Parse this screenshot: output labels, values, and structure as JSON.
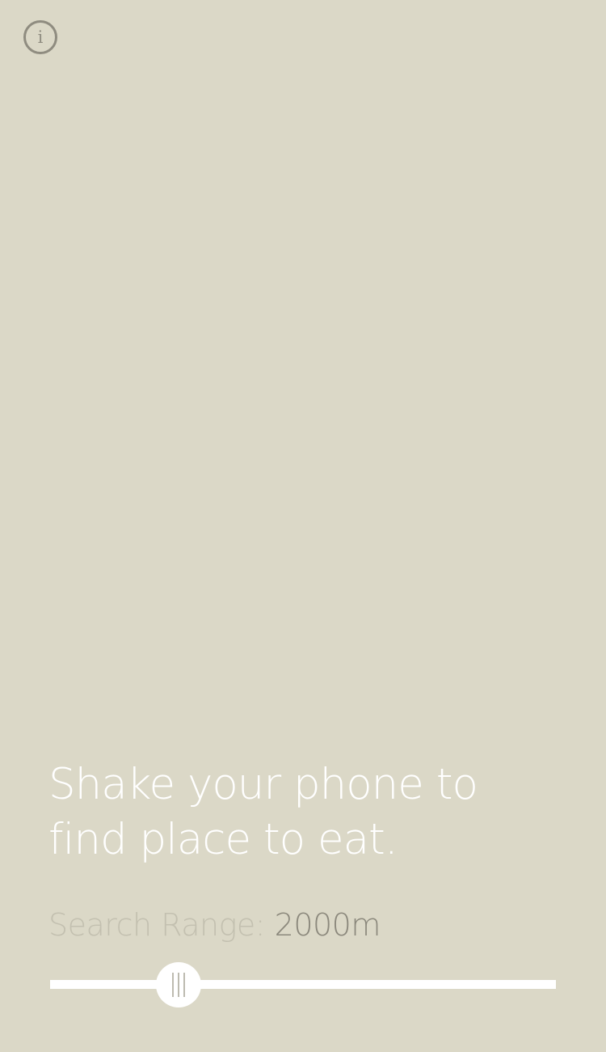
{
  "header": {
    "info_icon": "info-icon",
    "info_glyph": "i"
  },
  "main": {
    "prompt_line1": "Shake your phone to",
    "prompt_line2": "find place to eat.",
    "search_range_label": "Search Range:",
    "search_range_value": "2000m"
  },
  "slider": {
    "fraction": 0.254,
    "thumb_icon": "grip-lines-icon"
  },
  "colors": {
    "background": "#dbd8c7",
    "info_icon": "#8f8c80",
    "prompt_text": "#ffffff",
    "label_text": "#c3c0b0",
    "value_text": "#8b887c",
    "slider": "#ffffff"
  }
}
